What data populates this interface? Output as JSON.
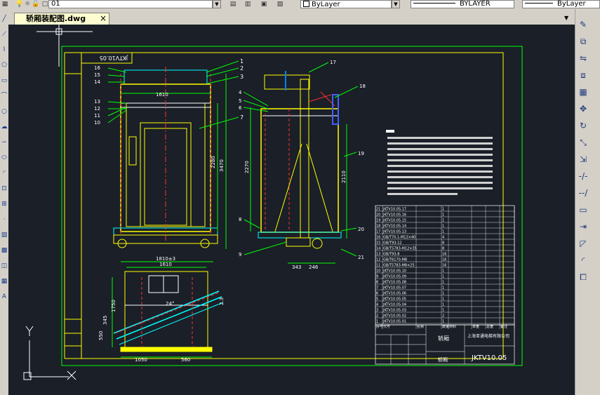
{
  "toolbar": {
    "layer_name": "01",
    "color_value": "ByLayer",
    "linetype_value": "BYLAYER",
    "lineweight_value": "ByLayer"
  },
  "tab": {
    "filename": "轿厢装配图.dwg"
  },
  "drawing": {
    "top_view_label": "JKTV10.05",
    "title_block": {
      "name": "轿厢",
      "company": "上海亚通电梯有限公司",
      "part_label": "轿厢",
      "drawing_number": "JKTV10.05"
    },
    "dims": {
      "width_top": "1610",
      "height_left": "2280",
      "height_right": "3470",
      "side_height": "2270",
      "side_height_right": "2110",
      "bottom_a": "343",
      "bottom_b": "246",
      "plan_width_outer": "1810±3",
      "plan_width_inner": "1610",
      "plan_bottom_left": "1050",
      "plan_bottom_right": "560",
      "plan_left_a": "345",
      "plan_left_b": "1750",
      "plan_left_c": "550",
      "plan_angle": "24°",
      "plan_right_a": "2.3"
    },
    "callouts_front": [
      "1",
      "2",
      "3",
      "7",
      "16",
      "15",
      "14",
      "13",
      "12",
      "11",
      "10"
    ],
    "callouts_side": [
      "17",
      "18",
      "4",
      "5",
      "6",
      "19",
      "20",
      "21",
      "8",
      "9"
    ],
    "bom_headers": [
      "序号",
      "代号",
      "名称",
      "数量",
      "材料",
      "单重",
      "总重",
      "备注"
    ],
    "bom_rows": [
      [
        "21",
        "JKTV10.05.17",
        "",
        "1",
        "",
        "",
        "",
        ""
      ],
      [
        "20",
        "JKTV10.05.16",
        "",
        "1",
        "",
        "",
        "",
        ""
      ],
      [
        "19",
        "JKTV10.05.15",
        "",
        "1",
        "",
        "",
        "",
        ""
      ],
      [
        "18",
        "JKTV10.05.14",
        "",
        "1",
        "",
        "",
        "",
        ""
      ],
      [
        "17",
        "JKTV10.05.13",
        "",
        "1",
        "",
        "",
        "",
        ""
      ],
      [
        "16",
        "GB/T70.1-M12×40",
        "",
        "4",
        "",
        "",
        "",
        ""
      ],
      [
        "15",
        "GB/T93-12",
        "",
        "8",
        "",
        "",
        "",
        ""
      ],
      [
        "14",
        "GB/T5783-M12×35",
        "",
        "8",
        "",
        "",
        "",
        ""
      ],
      [
        "13",
        "GB/T93-8",
        "",
        "16",
        "",
        "",
        "",
        ""
      ],
      [
        "12",
        "GB/T6170-M8",
        "",
        "16",
        "",
        "",
        "",
        ""
      ],
      [
        "11",
        "GB/T5783-M8×25",
        "",
        "16",
        "",
        "",
        "",
        ""
      ],
      [
        "10",
        "JKTV10.05.10",
        "",
        "1",
        "",
        "",
        "",
        ""
      ],
      [
        "9",
        "JKTV10.05.09",
        "",
        "1",
        "",
        "",
        "",
        ""
      ],
      [
        "8",
        "JKTV10.05.08",
        "",
        "1",
        "",
        "",
        "",
        ""
      ],
      [
        "7",
        "JKTV10.05.07",
        "",
        "1",
        "",
        "",
        "",
        ""
      ],
      [
        "6",
        "JKTV10.05.06",
        "",
        "1",
        "",
        "",
        "",
        ""
      ],
      [
        "5",
        "JKTV10.05.05",
        "",
        "1",
        "",
        "",
        "",
        ""
      ],
      [
        "4",
        "JKTV10.05.04",
        "",
        "1",
        "",
        "",
        "",
        ""
      ],
      [
        "3",
        "JKTV10.05.03",
        "",
        "1",
        "",
        "",
        "",
        ""
      ],
      [
        "2",
        "JKTV10.05.02",
        "",
        "2",
        "",
        "",
        "",
        ""
      ],
      [
        "1",
        "JKTV10.05.01",
        "",
        "1",
        "",
        "",
        "",
        ""
      ]
    ]
  }
}
